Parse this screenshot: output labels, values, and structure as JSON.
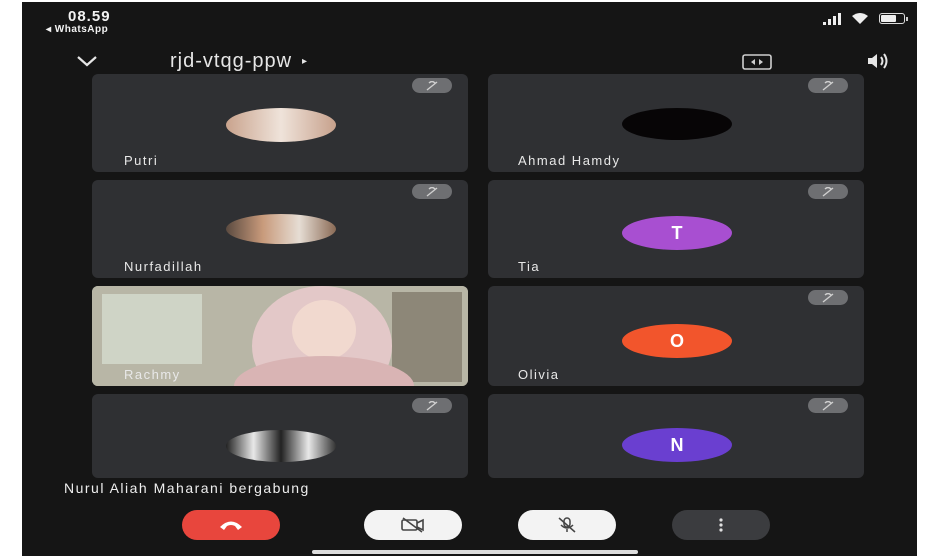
{
  "status_bar": {
    "time": "08.59",
    "back_app": "◂ WhatsApp"
  },
  "header": {
    "meeting_code": "rjd-vtqg-ppw",
    "caret": "▸"
  },
  "participants": [
    {
      "name": "Putri",
      "avatar": "photo"
    },
    {
      "name": "Ahmad Hamdy",
      "avatar": "photo-dark"
    },
    {
      "name": "Nurfadillah",
      "avatar": "photo"
    },
    {
      "name": "Tia",
      "avatar": "letter",
      "letter": "T",
      "color": "#a84fd1"
    },
    {
      "name": "Rachmy",
      "avatar": "video"
    },
    {
      "name": "Olivia",
      "avatar": "letter",
      "letter": "O",
      "color": "#f2552c"
    },
    {
      "name": "",
      "avatar": "photo"
    },
    {
      "name": "",
      "avatar": "letter",
      "letter": "N",
      "color": "#6a3fd0"
    }
  ],
  "toast": "Nurul Aliah Maharani bergabung",
  "controls": {
    "end_call_color": "#e8463d",
    "icons": [
      "phone-hangup-icon",
      "camera-off-icon",
      "mic-off-icon",
      "more-vertical-icon"
    ]
  }
}
